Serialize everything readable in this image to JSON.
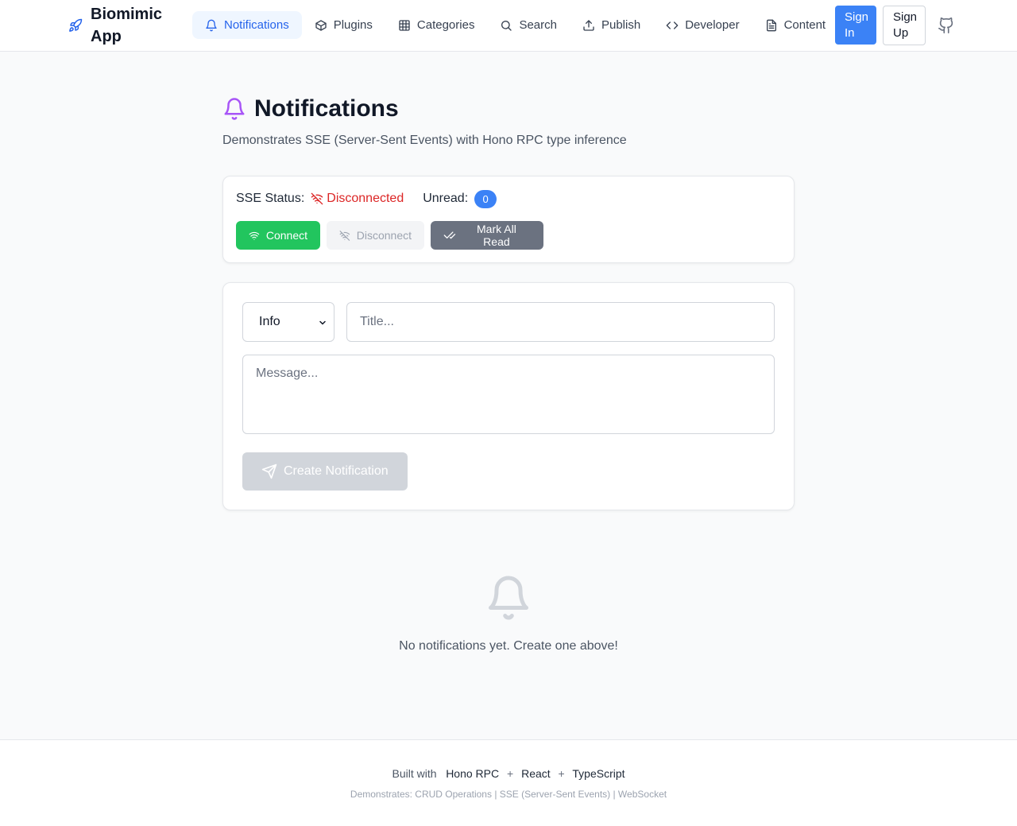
{
  "header": {
    "brand": "Biomimic App",
    "nav": [
      {
        "label": "Notifications",
        "icon": "bell-icon",
        "active": true
      },
      {
        "label": "Plugins",
        "icon": "package-icon"
      },
      {
        "label": "Categories",
        "icon": "grid-icon"
      },
      {
        "label": "Search",
        "icon": "search-icon"
      },
      {
        "label": "Publish",
        "icon": "upload-icon"
      },
      {
        "label": "Developer",
        "icon": "code-icon"
      },
      {
        "label": "Content",
        "icon": "document-icon"
      }
    ],
    "sign_in": "Sign In",
    "sign_up": "Sign Up",
    "accent": "#3b82f6"
  },
  "page": {
    "title": "Notifications",
    "subtitle": "Demonstrates SSE (Server-Sent Events) with Hono RPC type inference"
  },
  "status": {
    "sse_label": "SSE Status:",
    "sse_value": "Disconnected",
    "sse_color": "#dc2626",
    "unread_label": "Unread:",
    "unread_count": "0",
    "connect": "Connect",
    "disconnect": "Disconnect",
    "mark_all_read": "Mark All Read"
  },
  "form": {
    "type_selected": "Info",
    "title_placeholder": "Title...",
    "message_placeholder": "Message...",
    "create": "Create Notification"
  },
  "empty": {
    "text": "No notifications yet. Create one above!"
  },
  "footer": {
    "built_with": "Built with",
    "techs": [
      "Hono RPC",
      "React",
      "TypeScript"
    ],
    "plus": "+",
    "demonstrates": "Demonstrates: CRUD Operations | SSE (Server-Sent Events) | WebSocket"
  }
}
